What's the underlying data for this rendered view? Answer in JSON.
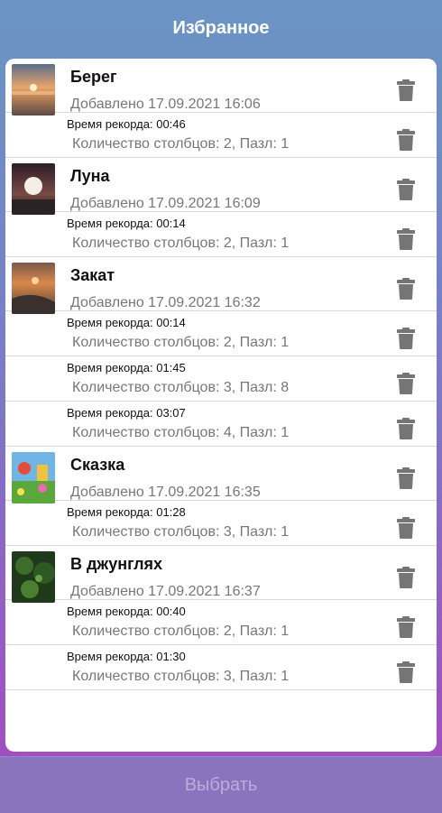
{
  "header": {
    "title": "Избранное"
  },
  "icons": {
    "delete": "trash-icon"
  },
  "favorites": [
    {
      "title": "Берег",
      "added": "Добавлено 17.09.2021 16:06",
      "thumb": "shore",
      "records": [
        {
          "time": "Время рекорда: 00:46",
          "info": "Количество столбцов: 2, Пазл: 1"
        }
      ]
    },
    {
      "title": "Луна",
      "added": "Добавлено 17.09.2021 16:09",
      "thumb": "moon",
      "records": [
        {
          "time": "Время рекорда: 00:14",
          "info": "Количество столбцов: 2, Пазл: 1"
        }
      ]
    },
    {
      "title": "Закат",
      "added": "Добавлено 17.09.2021 16:32",
      "thumb": "sunset",
      "records": [
        {
          "time": "Время рекорда: 00:14",
          "info": "Количество столбцов: 2, Пазл: 1"
        },
        {
          "time": "Время рекорда: 01:45",
          "info": "Количество столбцов: 3, Пазл: 8"
        },
        {
          "time": "Время рекорда: 03:07",
          "info": "Количество столбцов: 4, Пазл: 1"
        }
      ]
    },
    {
      "title": "Сказка",
      "added": "Добавлено 17.09.2021 16:35",
      "thumb": "fairytale",
      "records": [
        {
          "time": "Время рекорда: 01:28",
          "info": "Количество столбцов: 3, Пазл: 1"
        }
      ]
    },
    {
      "title": "В джунглях",
      "added": "Добавлено 17.09.2021 16:37",
      "thumb": "jungle",
      "records": [
        {
          "time": "Время рекорда: 00:40",
          "info": "Количество столбцов: 2, Пазл: 1"
        },
        {
          "time": "Время рекорда: 01:30",
          "info": "Количество столбцов: 3, Пазл: 1"
        }
      ]
    }
  ],
  "footer": {
    "select_label": "Выбрать"
  }
}
